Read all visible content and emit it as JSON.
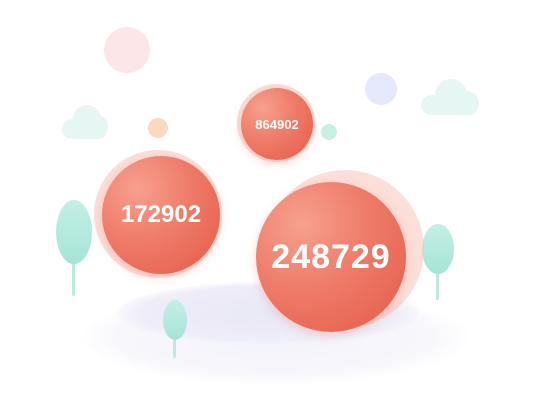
{
  "bubbles": {
    "large": {
      "label": "248729"
    },
    "medium": {
      "label": "172902"
    },
    "small": {
      "label": "864902"
    }
  },
  "colors": {
    "bubble_fill": "#ee7b68",
    "bubble_halo": "#fac4ba",
    "tree": "#a6e4d7",
    "cloud": "#e5f6f3",
    "ground": "#eeedf8"
  }
}
